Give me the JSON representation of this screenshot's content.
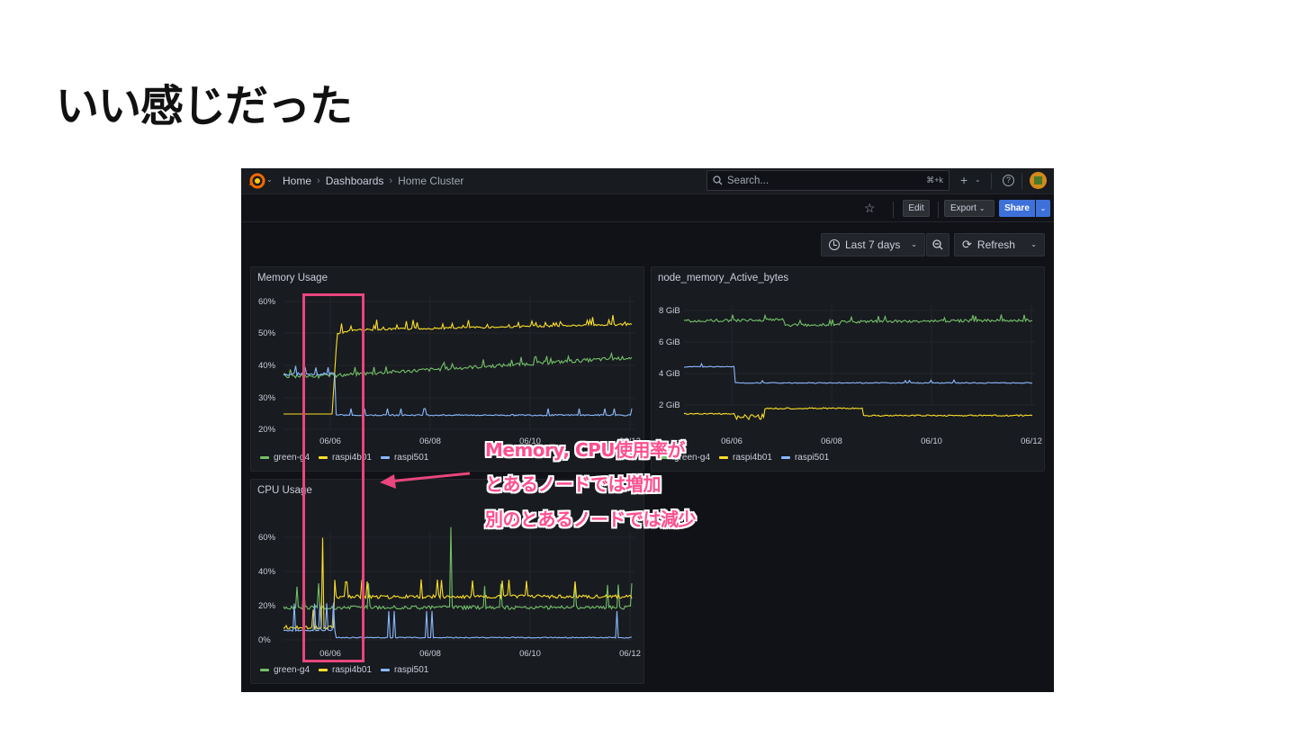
{
  "slide": {
    "title": "いい感じだった"
  },
  "nav": {
    "breadcrumbs": [
      "Home",
      "Dashboards",
      "Home Cluster"
    ],
    "search_placeholder": "Search...",
    "search_shortcut": "⌘+k",
    "plus": "+"
  },
  "toolbar": {
    "edit": "Edit",
    "export": "Export",
    "share": "Share"
  },
  "time": {
    "range": "Last 7 days",
    "refresh": "Refresh"
  },
  "colors": {
    "green": "#73bf69",
    "yellow": "#fade2a",
    "blue": "#8ab8ff",
    "accent": "#e8467c"
  },
  "annotation": {
    "lines": [
      "Memory, CPU使用率が",
      "とあるノードでは増加",
      "別のとあるノードでは減少"
    ]
  },
  "panels": {
    "memory": {
      "title": "Memory Usage",
      "y_ticks": [
        "60%",
        "50%",
        "40%",
        "30%",
        "20%"
      ],
      "x_ticks": [
        "06/06",
        "06/08",
        "06/10",
        "06/12"
      ],
      "legend": [
        "green-g4",
        "raspi4b01",
        "raspi501"
      ]
    },
    "active": {
      "title": "node_memory_Active_bytes",
      "y_ticks": [
        "8 GiB",
        "6 GiB",
        "4 GiB",
        "2 GiB"
      ],
      "x_ticks": [
        "06/06",
        "06/08",
        "06/10",
        "06/12"
      ],
      "legend": [
        "green-g4",
        "raspi4b01",
        "raspi501"
      ]
    },
    "cpu": {
      "title": "CPU Usage",
      "y_ticks": [
        "60%",
        "40%",
        "20%",
        "0%"
      ],
      "x_ticks": [
        "06/06",
        "06/08",
        "06/10",
        "06/12"
      ],
      "legend": [
        "green-g4",
        "raspi4b01",
        "raspi501"
      ]
    }
  }
}
